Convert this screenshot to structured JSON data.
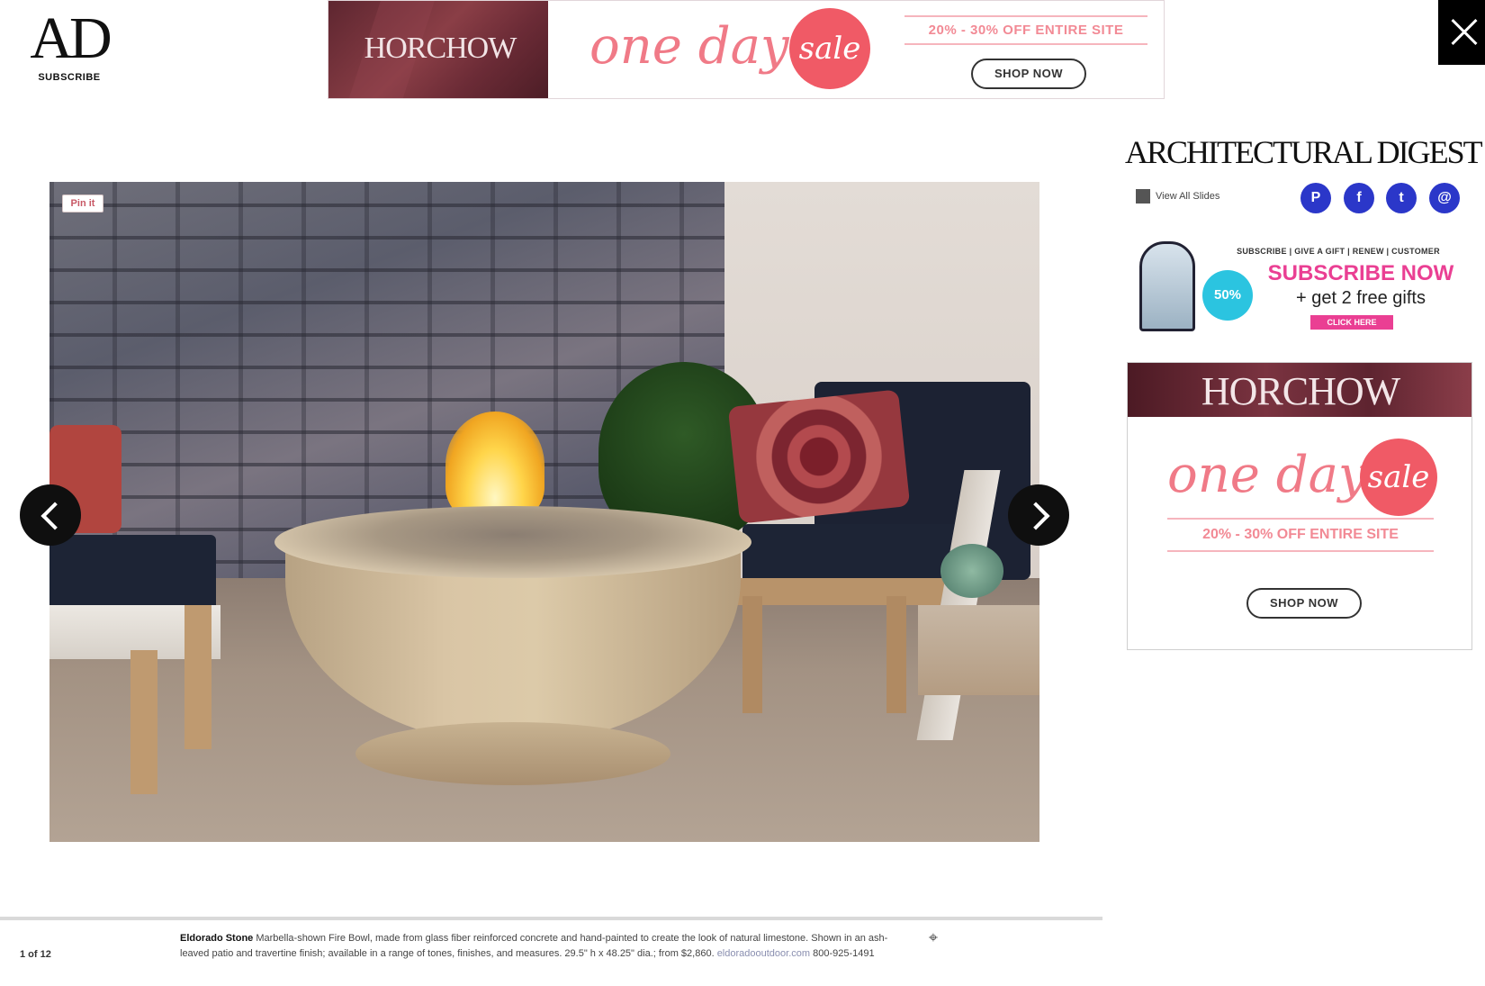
{
  "header": {
    "logo_mark": "AD",
    "subscribe_label": "SUBSCRIBE"
  },
  "top_ad": {
    "brand": "HORCHOW",
    "script": "one day",
    "sale": "sale",
    "offer": "20% - 30% OFF ENTIRE SITE",
    "button": "SHOP NOW"
  },
  "slideshow": {
    "badge": "Pin it",
    "counter": "1 of 12",
    "caption_title": "Eldorado Stone",
    "caption_body": "Marbella-shown Fire Bowl, made from glass fiber reinforced concrete and hand-painted to create the look of natural limestone. Shown in an ash-leaved patio and travertine finish; available in a range of tones, finishes, and measures. 29.5\" h x 48.25\" dia.; from $2,860.",
    "caption_link": "eldoradooutdoor.com",
    "caption_phone": "800-925-1491",
    "colors": {
      "arrow_bg": "#0f0f0f",
      "divider": "#d9d9d9"
    }
  },
  "rail": {
    "title": "ARCHITECTURAL DIGEST",
    "view_all": "View All Slides",
    "social_icons": [
      "pinterest-icon",
      "facebook-icon",
      "twitter-icon",
      "email-icon"
    ],
    "social_glyphs": [
      "P",
      "f",
      "t",
      "@"
    ],
    "social_color": "#2b37c9"
  },
  "subscribe_ad": {
    "nav": "SUBSCRIBE  |  GIVE A GIFT  |  RENEW  |  CUSTOMER",
    "discount": "50%",
    "headline": "SUBSCRIBE NOW",
    "gifts": "+ get 2 free gifts",
    "button": "CLICK HERE",
    "accent": "#ea3f93"
  },
  "side_ad": {
    "brand": "HORCHOW",
    "script": "one day",
    "sale": "sale",
    "offer": "20% - 30% OFF ENTIRE SITE",
    "button": "SHOP NOW",
    "accent": "#f05a66"
  }
}
